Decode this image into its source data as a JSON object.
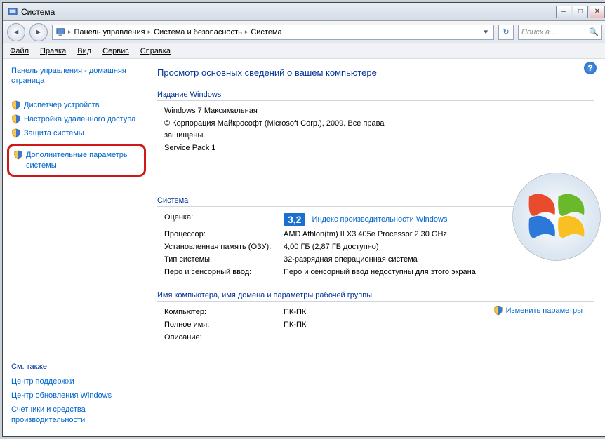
{
  "titlebar": {
    "title": "Система"
  },
  "breadcrumb": {
    "items": [
      "Панель управления",
      "Система и безопасность",
      "Система"
    ]
  },
  "search": {
    "placeholder": "Поиск в ..."
  },
  "menubar": {
    "file": "Файл",
    "edit": "Правка",
    "view": "Вид",
    "service": "Сервис",
    "help": "Справка"
  },
  "sidebar": {
    "home": "Панель управления - домашняя страница",
    "links": [
      "Диспетчер устройств",
      "Настройка удаленного доступа",
      "Защита системы",
      "Дополнительные параметры системы"
    ],
    "see_also_title": "См. также",
    "see_also": [
      "Центр поддержки",
      "Центр обновления Windows",
      "Счетчики и средства производительности"
    ]
  },
  "main": {
    "heading": "Просмотр основных сведений о вашем компьютере",
    "edition_title": "Издание Windows",
    "edition": "Windows 7 Максимальная",
    "copyright": "© Корпорация Майкрософт (Microsoft Corp.), 2009. Все права защищены.",
    "service_pack": "Service Pack 1",
    "system_title": "Система",
    "rating_label": "Оценка:",
    "rating_value": "3,2",
    "rating_link": "Индекс производительности Windows",
    "cpu_label": "Процессор:",
    "cpu_value": "AMD Athlon(tm) II X3 405e Processor   2.30 GHz",
    "ram_label": "Установленная память (ОЗУ):",
    "ram_value": "4,00 ГБ (2,87 ГБ доступно)",
    "type_label": "Тип системы:",
    "type_value": "32-разрядная операционная система",
    "pen_label": "Перо и сенсорный ввод:",
    "pen_value": "Перо и сенсорный ввод недоступны для этого экрана",
    "name_title": "Имя компьютера, имя домена и параметры рабочей группы",
    "comp_label": "Компьютер:",
    "comp_value": "ПК-ПК",
    "full_label": "Полное имя:",
    "full_value": "ПК-ПК",
    "desc_label": "Описание:",
    "change_link": "Изменить параметры"
  }
}
